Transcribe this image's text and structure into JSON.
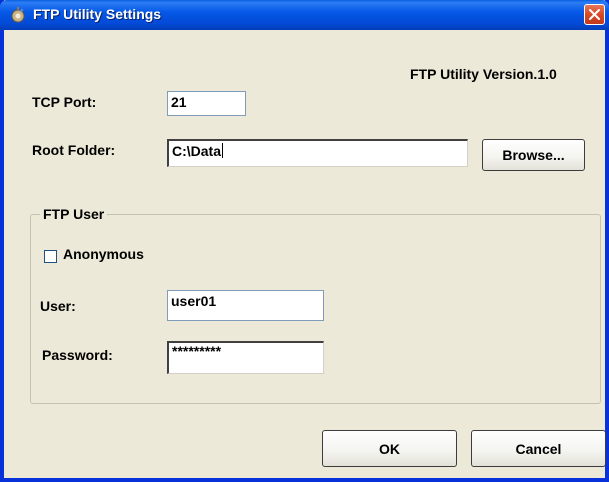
{
  "window": {
    "title": "FTP Utility Settings"
  },
  "version_text": "FTP Utility Version.1.0",
  "tcp_port": {
    "label": "TCP Port:",
    "value": "21"
  },
  "root_folder": {
    "label": "Root Folder:",
    "value": "C:\\Data",
    "browse_label": "Browse..."
  },
  "ftp_user": {
    "group_title": "FTP User",
    "anonymous_label": "Anonymous",
    "anonymous_checked": false,
    "user_label": "User:",
    "user_value": "user01",
    "password_label": "Password:",
    "password_value": "*********"
  },
  "buttons": {
    "ok_label": "OK",
    "cancel_label": "Cancel"
  }
}
